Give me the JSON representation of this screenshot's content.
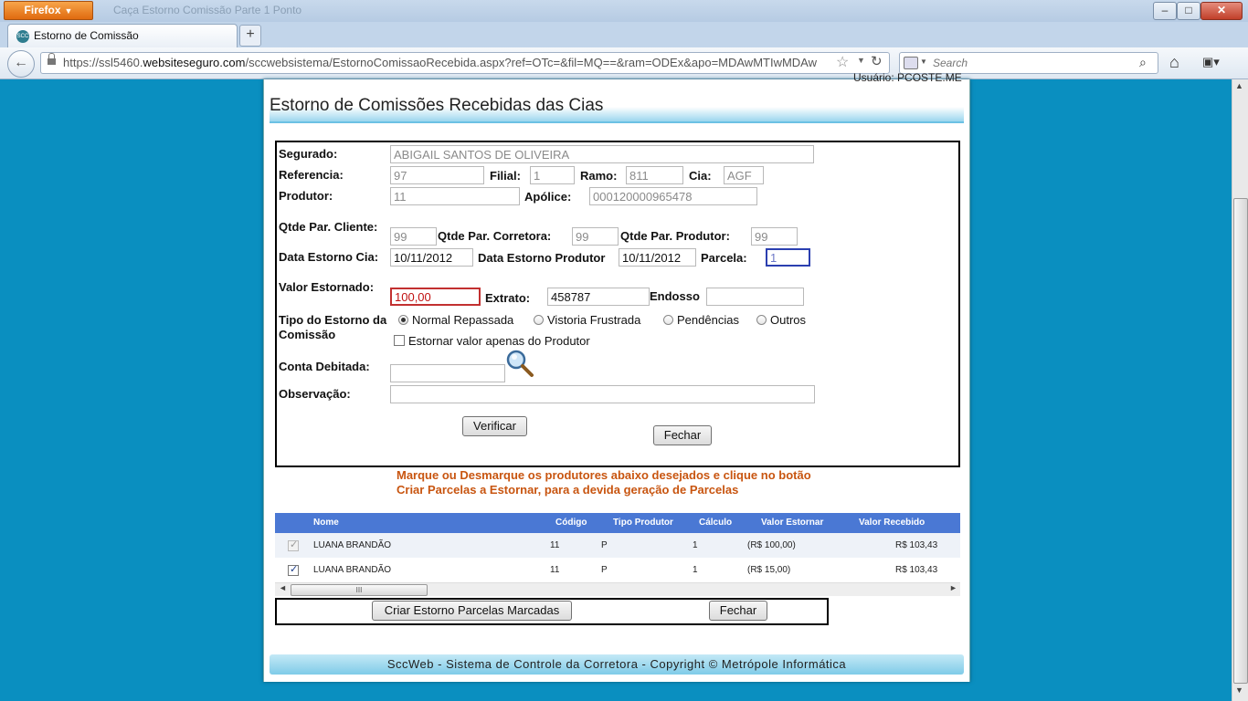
{
  "browser": {
    "menu_label": "Firefox",
    "window_title": "Caça Estorno Comissão Parte 1 Ponto",
    "tab_label": "Estorno de Comissão",
    "tab_icon_text": "SCC",
    "url_prefix": "https://ssl5460.",
    "url_host": "websiteseguro.com",
    "url_path": "/sccwebsistema/EstornoComissaoRecebida.aspx?ref=OTc=&fil=MQ==&ram=ODEx&apo=MDAwMTIwMDAw",
    "search_placeholder": "Search"
  },
  "page": {
    "top_userline": "Usuário: PCOSTE.ME",
    "title": "Estorno de Comissões Recebidas das Cias"
  },
  "form": {
    "segurado_label": "Segurado:",
    "segurado_value": "ABIGAIL SANTOS DE OLIVEIRA",
    "referencia_label": "Referencia:",
    "referencia_value": "97",
    "filial_label": "Filial:",
    "filial_value": "1",
    "ramo_label": "Ramo:",
    "ramo_value": "811",
    "cia_label": "Cia:",
    "cia_value": "AGF",
    "produtor_label": "Produtor:",
    "produtor_value": "11",
    "apolice_label": "Apólice:",
    "apolice_value": "000120000965478",
    "qtde_cliente_label": "Qtde Par. Cliente:",
    "qtde_cliente_value": "99",
    "qtde_corretora_label": "Qtde Par. Corretora:",
    "qtde_corretora_value": "99",
    "qtde_produtor_label": "Qtde Par. Produtor:",
    "qtde_produtor_value": "99",
    "data_estorno_cia_label": "Data Estorno Cia:",
    "data_estorno_cia_value": "10/11/2012",
    "data_estorno_produtor_label": "Data Estorno Produtor",
    "data_estorno_produtor_value": "10/11/2012",
    "parcela_label": "Parcela:",
    "parcela_value": "1",
    "valor_estornado_label": "Valor Estornado:",
    "valor_estornado_value": "100,00",
    "extrato_label": "Extrato:",
    "extrato_value": "458787",
    "endosso_label": "Endosso",
    "endosso_value": "",
    "tipo_label_1": "Tipo do Estorno da",
    "tipo_label_2": "Comissão",
    "tipo_options": [
      "Normal Repassada",
      "Vistoria Frustrada",
      "Pendências",
      "Outros"
    ],
    "tipo_selected": "Normal Repassada",
    "checkbox_produtor_label": "Estornar valor apenas do Produtor",
    "checkbox_produtor_checked": false,
    "conta_debitada_label": "Conta Debitada:",
    "conta_debitada_value": "",
    "observacao_label": "Observação:",
    "observacao_value": "",
    "verificar_label": "Verificar",
    "fechar_label": "Fechar"
  },
  "instructions": {
    "line1": "Marque ou Desmarque os produtores abaixo desejados e clique no botão",
    "line2": "Criar Parcelas a Estornar, para a devida geração de Parcelas",
    "color": "#c85510"
  },
  "grid": {
    "header_color": "#4a78d4",
    "columns": [
      "Nome",
      "Código",
      "Tipo Produtor",
      "Cálculo",
      "Valor Estornar",
      "Valor Recebido"
    ],
    "rows": [
      {
        "checked": true,
        "disabled": true,
        "nome": "LUANA BRANDÃO",
        "codigo": "11",
        "tipo": "P",
        "calculo": "1",
        "valor_estornar": "(R$ 100,00)",
        "valor_recebido": "R$ 103,43"
      },
      {
        "checked": true,
        "disabled": false,
        "nome": "LUANA BRANDÃO",
        "codigo": "11",
        "tipo": "P",
        "calculo": "1",
        "valor_estornar": "(R$ 15,00)",
        "valor_recebido": "R$ 103,43"
      }
    ],
    "scroll_thumb_text": "III"
  },
  "actions": {
    "criar_label": "Criar  Estorno Parcelas Marcadas",
    "fechar_label": "Fechar"
  },
  "footer": {
    "text": "SccWeb - Sistema de Controle da Corretora - Copyright © Metrópole Informática"
  }
}
